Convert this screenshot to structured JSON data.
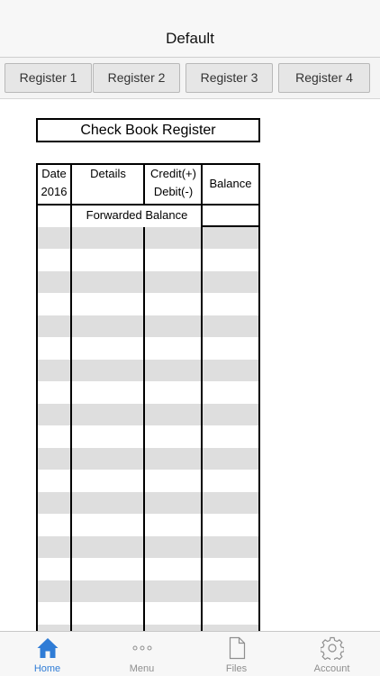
{
  "navbar": {
    "title": "Default"
  },
  "tabs": [
    {
      "label": "Register 1"
    },
    {
      "label": "Register 2"
    },
    {
      "label": "Register 3"
    },
    {
      "label": "Register 4"
    }
  ],
  "register": {
    "title": "Check Book Register",
    "columns": {
      "date_line1": "Date",
      "date_line2": "2016",
      "details": "Details",
      "credit": "Credit(+)",
      "debit": "Debit(-)",
      "balance": "Balance"
    },
    "forwarded_balance_label": "Forwarded Balance"
  },
  "tabbar": {
    "items": [
      {
        "label": "Home",
        "icon": "home-icon"
      },
      {
        "label": "Menu",
        "icon": "more-dots-icon"
      },
      {
        "label": "Files",
        "icon": "file-icon"
      },
      {
        "label": "Account",
        "icon": "gear-icon"
      }
    ]
  },
  "colors": {
    "accent": "#2f7cd6",
    "stripe": "#dedede"
  }
}
